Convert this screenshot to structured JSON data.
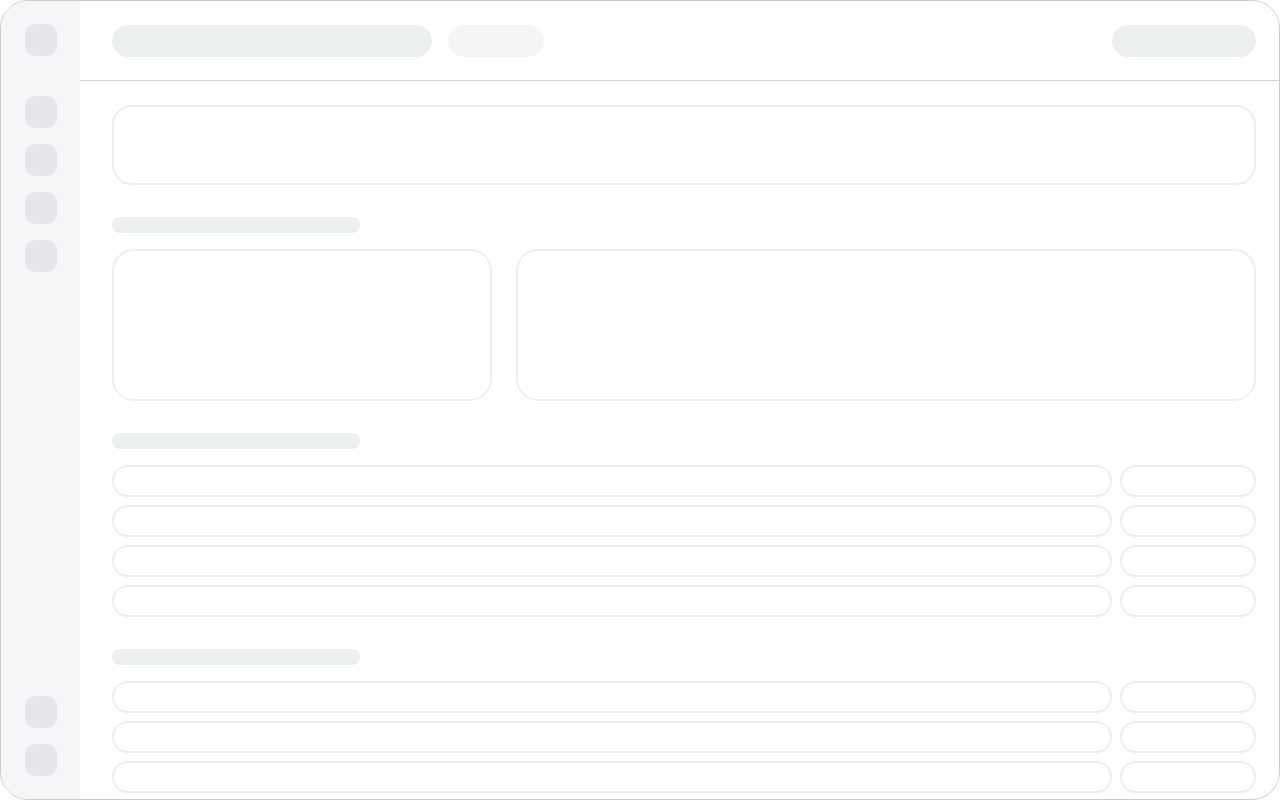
{
  "sidebar": {
    "top_items": [
      {
        "kind": "logo"
      },
      {
        "kind": "nav"
      },
      {
        "kind": "nav"
      },
      {
        "kind": "nav"
      },
      {
        "kind": "nav"
      }
    ],
    "bottom_items": [
      {
        "kind": "nav"
      },
      {
        "kind": "nav"
      }
    ]
  },
  "header": {
    "items": [
      {
        "kind": "title"
      },
      {
        "kind": "chip"
      }
    ],
    "actions": [
      {
        "kind": "button"
      }
    ]
  },
  "sections": [
    {
      "kind": "banner"
    },
    {
      "kind": "cards",
      "cards": [
        {
          "kind": "narrow"
        },
        {
          "kind": "wide"
        }
      ]
    },
    {
      "kind": "list",
      "rows": [
        {
          "kind": "row"
        },
        {
          "kind": "row"
        },
        {
          "kind": "row"
        },
        {
          "kind": "row"
        }
      ]
    },
    {
      "kind": "list",
      "rows": [
        {
          "kind": "row"
        },
        {
          "kind": "row"
        },
        {
          "kind": "row"
        }
      ]
    }
  ]
}
